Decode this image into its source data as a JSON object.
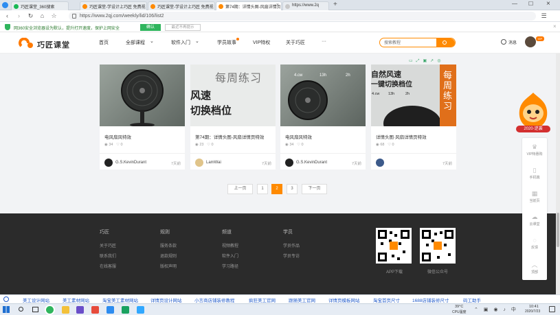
{
  "browser": {
    "tabs": [
      {
        "label": "巧匠课堂_360搜索",
        "active": false
      },
      {
        "label": "巧匠课堂-学设计上巧匠 免费视",
        "active": false
      },
      {
        "label": "巧匠课堂-学设计上巧匠 免费视",
        "active": false
      },
      {
        "label": "第74期：详情头图-风扇详情页",
        "active": true
      },
      {
        "label": "https://www.2q",
        "active": false
      }
    ],
    "new_tab": "+",
    "url": "https://www.2qj.com/weekly/lid/106/list2",
    "security_notice": "网360安全浏览器设为默认，提升打开速度，保护上网安全",
    "confirm_btn": "确认",
    "dismiss_btn": "最近不再提示"
  },
  "site": {
    "logo": "巧匠课堂",
    "nav": [
      "首页",
      "全部课程",
      "软件入门",
      "学员故事",
      "VIP特权",
      "关于巧匠",
      "···"
    ],
    "search_placeholder": "搜索教程",
    "message": "消息"
  },
  "cards": [
    {
      "title": "电风扇风特效",
      "views": "34",
      "likes": "0",
      "author": "G.S.KevinDurant",
      "time": "7天前"
    },
    {
      "title": "第74期：详情头图-风扇详情页特效",
      "views": "23",
      "likes": "0",
      "author": "LamWai",
      "time": "7天前",
      "thumb_text": [
        "每周练习",
        "风速",
        "切换档位"
      ]
    },
    {
      "title": "电风扇风特效",
      "views": "34",
      "likes": "0",
      "author": "G.S.KevinDurant",
      "time": "7天前",
      "thumb_labels": [
        "4.cw",
        "13h",
        "2h"
      ]
    },
    {
      "title": "详情头图·风扇详情页特效",
      "views": "68",
      "likes": "0",
      "author": "",
      "time": "7天前",
      "thumb_text": [
        "自然风速",
        "一键切换档位",
        "每周练习"
      ],
      "thumb_labels": [
        "4.cw",
        "13h",
        "2h"
      ]
    }
  ],
  "pagination": {
    "prev": "上一页",
    "pages": [
      "1",
      "2",
      "3"
    ],
    "current": "2",
    "next": "下一页"
  },
  "footer": {
    "columns": [
      {
        "heading": "巧匠",
        "links": [
          "关于巧匠",
          "联系我们",
          "在线客服"
        ]
      },
      {
        "heading": "规则",
        "links": [
          "服务条款",
          "退款规则",
          "版权声明"
        ]
      },
      {
        "heading": "频道",
        "links": [
          "视频教程",
          "软件入门",
          "学习路径"
        ]
      },
      {
        "heading": "学员",
        "links": [
          "学员作品",
          "学员专访"
        ]
      }
    ],
    "qr_labels": [
      "APP下载",
      "微信公众号"
    ]
  },
  "sidebar": {
    "promo": "2020·逆袭",
    "items": [
      "VIP特惠购",
      "手机端",
      "当前页",
      "云课堂",
      "反馈",
      "顶部"
    ]
  },
  "link_bar": [
    "美工设计网站",
    "美工素材网站",
    "淘宝美工素材网站",
    "详情页设计网站",
    "小言商店铺装修教程",
    "疯狂美工官网",
    "跟随美工官网",
    "详情页模板网站",
    "淘宝首页尺寸",
    "1688店铺装修尺寸",
    "码工助手"
  ],
  "taskbar": {
    "weather": "39°C",
    "weather_label": "CPU温度",
    "time": "10:41",
    "date": "2020/7/23"
  }
}
